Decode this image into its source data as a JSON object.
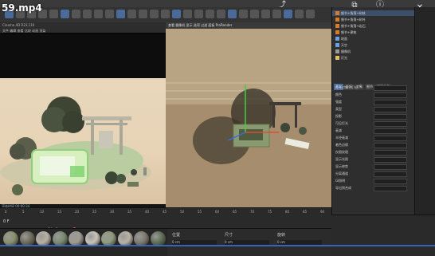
{
  "video_title": "59.mp4",
  "menubar": {
    "items": [
      "文件",
      "编辑",
      "创建",
      "模式",
      "选择",
      "工具",
      "网格",
      "样条",
      "体积",
      "运动图形",
      "角色",
      "动画",
      "模拟",
      "跟踪器",
      "渲染",
      "扩展",
      "窗口",
      "帮助"
    ]
  },
  "top_icons": [
    "share-icon",
    "link-icon",
    "info-icon"
  ],
  "render_window": {
    "header_line1": "Cinema 4D R23.110",
    "header_line2": "文件  编辑  查看  比较  动画  渲染",
    "log_lines": [
      "渲染时间 00:00:34",
      "图片: 1080 x 1080",
      "帧: 0"
    ]
  },
  "viewport": {
    "header": "查看  摄像机  显示  选项  过滤  面板  ProRender"
  },
  "object_manager": {
    "items": [
      {
        "label": "细节+角落+树枝",
        "color": "#d77a2a"
      },
      {
        "label": "细节+角落+树叶",
        "color": "#d77a2a"
      },
      {
        "label": "细节+角落+岩石",
        "color": "#d77a2a"
      },
      {
        "label": "细节+建筑",
        "color": "#d77a2a"
      },
      {
        "label": "地面",
        "color": "#6aa0e0"
      },
      {
        "label": "天空",
        "color": "#6aa0e0"
      },
      {
        "label": "摄像机",
        "color": "#9a9a9a"
      },
      {
        "label": "灯光",
        "color": "#e0c060"
      }
    ]
  },
  "attribute_manager": {
    "tabs": [
      "基本",
      "坐标",
      "对象",
      "细节",
      "平滑着色"
    ],
    "rows": [
      "灯光对象 [灯光]",
      "颜色",
      "强度",
      "类型",
      "投影",
      "可见灯光",
      "衰减",
      "半径衰减",
      "着色边缘",
      "仅限纹理",
      "显示光照",
      "显示修剪",
      "分离通道",
      "GI照明",
      "导出到合成"
    ]
  },
  "timeline": {
    "frame_labels": [
      "0",
      "5",
      "10",
      "15",
      "20",
      "25",
      "30",
      "35",
      "40",
      "45",
      "50",
      "55",
      "60",
      "65",
      "70",
      "75",
      "80",
      "85",
      "90"
    ],
    "current_frame": "0 F"
  },
  "materials": {
    "count_visible": 10,
    "swatches": [
      "#8a8f6a",
      "#6e6a5a",
      "#b8b0a0",
      "#7a8a70",
      "#a09a90",
      "#c9c2b6",
      "#8d9b7a",
      "#b9b2a6",
      "#7f7a6e",
      "#5f6f53"
    ]
  },
  "coords_panel": {
    "headers": [
      "位置",
      "尺寸",
      "旋转"
    ],
    "values": [
      "0 cm",
      "0 cm",
      "0 cm"
    ]
  }
}
